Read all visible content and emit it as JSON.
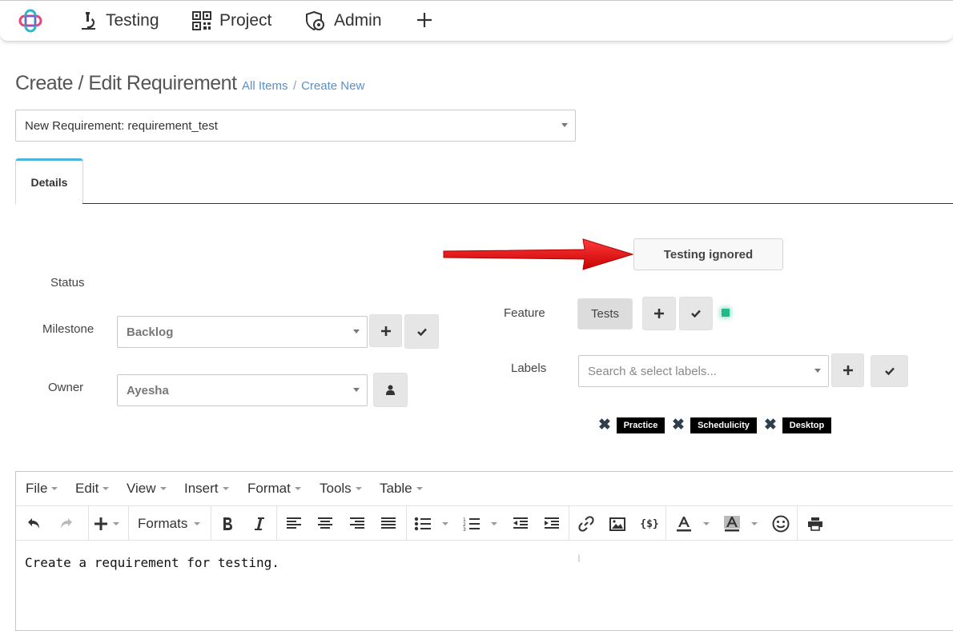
{
  "nav": {
    "items": [
      {
        "label": "Testing",
        "icon": "microscope-icon"
      },
      {
        "label": "Project",
        "icon": "qr-code-icon"
      },
      {
        "label": "Admin",
        "icon": "shield-gear-icon"
      }
    ],
    "add_icon": "plus-icon"
  },
  "page": {
    "title": "Create / Edit Requirement",
    "breadcrumb": {
      "all_items": "All Items",
      "separator": "/",
      "create_new": "Create New"
    }
  },
  "requirement_select": {
    "value": "New Requirement: requirement_test"
  },
  "tabs": [
    {
      "label": "Details",
      "active": true
    }
  ],
  "form": {
    "testing_ignored_button": "Testing ignored",
    "status_label": "Status",
    "milestone_label": "Milestone",
    "milestone_value": "Backlog",
    "owner_label": "Owner",
    "owner_value": "Ayesha",
    "feature_label": "Feature",
    "feature_value": "Tests",
    "labels_label": "Labels",
    "labels_placeholder": "Search & select labels...",
    "selected_labels": [
      "Practice",
      "Schedulicity",
      "Desktop"
    ]
  },
  "editor": {
    "menu": [
      "File",
      "Edit",
      "View",
      "Insert",
      "Format",
      "Tools",
      "Table"
    ],
    "formats_label": "Formats",
    "content": "Create a requirement for testing."
  },
  "colors": {
    "accent_tab": "#4bb6d9",
    "link": "#5a8fc8",
    "arrow": "#e81010",
    "feature_indicator": "#1fb98a"
  }
}
